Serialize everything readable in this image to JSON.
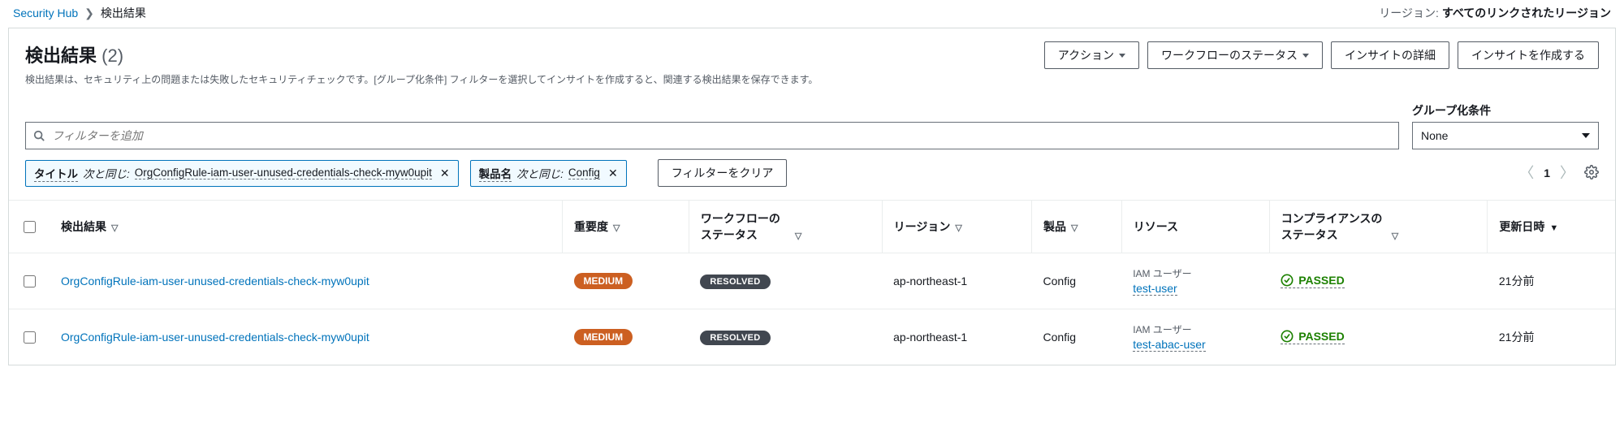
{
  "breadcrumb": {
    "root": "Security Hub",
    "current": "検出結果"
  },
  "region": {
    "label": "リージョン:",
    "value": "すべてのリンクされたリージョン"
  },
  "title": "検出結果",
  "count": "2",
  "description": "検出結果は、セキュリティ上の問題または失敗したセキュリティチェックです。[グループ化条件] フィルターを選択してインサイトを作成すると、関連する検出結果を保存できます。",
  "header_actions": {
    "actions": "アクション",
    "workflow_status": "ワークフローのステータス",
    "insight_detail": "インサイトの詳細",
    "create_insight": "インサイトを作成する"
  },
  "filter": {
    "placeholder": "フィルターを追加"
  },
  "groupby": {
    "label": "グループ化条件",
    "value": "None"
  },
  "tokens": [
    {
      "key": "タイトル",
      "op": "次と同じ:",
      "value": "OrgConfigRule-iam-user-unused-credentials-check-myw0upit"
    },
    {
      "key": "製品名",
      "op": "次と同じ:",
      "value": "Config"
    }
  ],
  "clear_filters": "フィルターをクリア",
  "pagination": {
    "page": "1"
  },
  "columns": {
    "finding": "検出結果",
    "severity": "重要度",
    "workflow": "ワークフローのステータス",
    "region": "リージョン",
    "product": "製品",
    "resource": "リソース",
    "compliance": "コンプライアンスのステータス",
    "updated": "更新日時"
  },
  "rows": [
    {
      "finding": "OrgConfigRule-iam-user-unused-credentials-check-myw0upit",
      "severity": "MEDIUM",
      "workflow": "RESOLVED",
      "region": "ap-northeast-1",
      "product": "Config",
      "resource_type": "IAM ユーザー",
      "resource_name": "test-user",
      "compliance": "PASSED",
      "updated": "21分前"
    },
    {
      "finding": "OrgConfigRule-iam-user-unused-credentials-check-myw0upit",
      "severity": "MEDIUM",
      "workflow": "RESOLVED",
      "region": "ap-northeast-1",
      "product": "Config",
      "resource_type": "IAM ユーザー",
      "resource_name": "test-abac-user",
      "compliance": "PASSED",
      "updated": "21分前"
    }
  ]
}
